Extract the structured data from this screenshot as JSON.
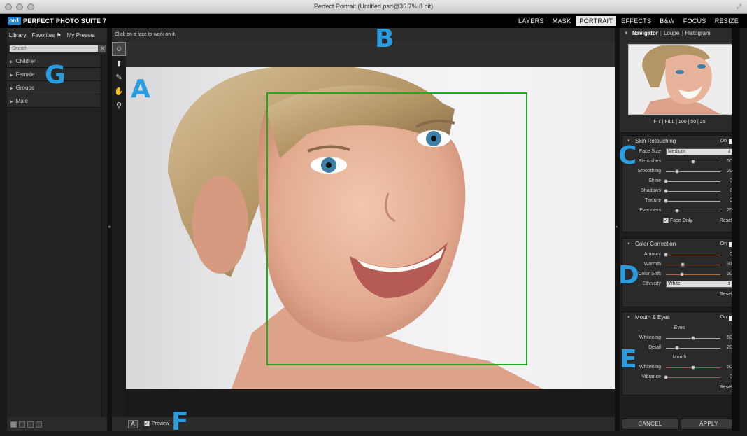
{
  "window": {
    "title": "Perfect Portrait (Untitled.psd@35.7% 8 bit)"
  },
  "app": {
    "logo": "on1",
    "name": "PERFECT PHOTO SUITE 7",
    "modules": [
      "LAYERS",
      "MASK",
      "PORTRAIT",
      "EFFECTS",
      "B&W",
      "FOCUS",
      "RESIZE"
    ],
    "active_module": "PORTRAIT"
  },
  "browser": {
    "tabs": [
      "Library",
      "Favorites",
      "My Presets"
    ],
    "search": {
      "placeholder": "Search",
      "clear": "x"
    },
    "items": [
      "Children",
      "Female",
      "Groups",
      "Male"
    ]
  },
  "canvas": {
    "instruction": "Click on a face to work on it.",
    "face_box_color": "#1faa1f"
  },
  "bottom": {
    "a_label": "A",
    "preview_label": "Preview",
    "preview_checked": true
  },
  "navigator": {
    "tabs": [
      "Navigator",
      "Loupe",
      "Histogram"
    ],
    "zoom_options": "FIT | FILL | 100 | 50 | 25"
  },
  "skin": {
    "title": "Skin Retouching",
    "on_label": "On",
    "face_size_label": "Face Size",
    "face_size": "Medium",
    "sliders": [
      {
        "label": "Blemishes",
        "value": 50
      },
      {
        "label": "Smoothing",
        "value": 20
      },
      {
        "label": "Shine",
        "value": 0
      },
      {
        "label": "Shadows",
        "value": 0
      },
      {
        "label": "Texture",
        "value": 0
      },
      {
        "label": "Evenness",
        "value": 20
      }
    ],
    "face_only_label": "Face Only",
    "reset": "Reset"
  },
  "color": {
    "title": "Color Correction",
    "on_label": "On",
    "sliders": [
      {
        "label": "Amount",
        "value": 0
      },
      {
        "label": "Warmth",
        "value": 31
      },
      {
        "label": "Color Shift",
        "value": 30
      }
    ],
    "ethnicity_label": "Ethnicity",
    "ethnicity": "White",
    "reset": "Reset"
  },
  "mouth_eyes": {
    "title": "Mouth & Eyes",
    "on_label": "On",
    "eyes_label": "Eyes",
    "mouth_label": "Mouth",
    "eyes_sliders": [
      {
        "label": "Whitening",
        "value": 50
      },
      {
        "label": "Detail",
        "value": 20
      }
    ],
    "mouth_sliders": [
      {
        "label": "Whitening",
        "value": 50
      },
      {
        "label": "Vibrance",
        "value": 0
      }
    ],
    "reset": "Reset"
  },
  "actions": {
    "cancel": "CANCEL",
    "apply": "APPLY"
  },
  "markers": [
    "A",
    "B",
    "C",
    "D",
    "E",
    "F",
    "G"
  ],
  "colors": {
    "accent": "#2a9de0",
    "face_box": "#1faa1f"
  }
}
